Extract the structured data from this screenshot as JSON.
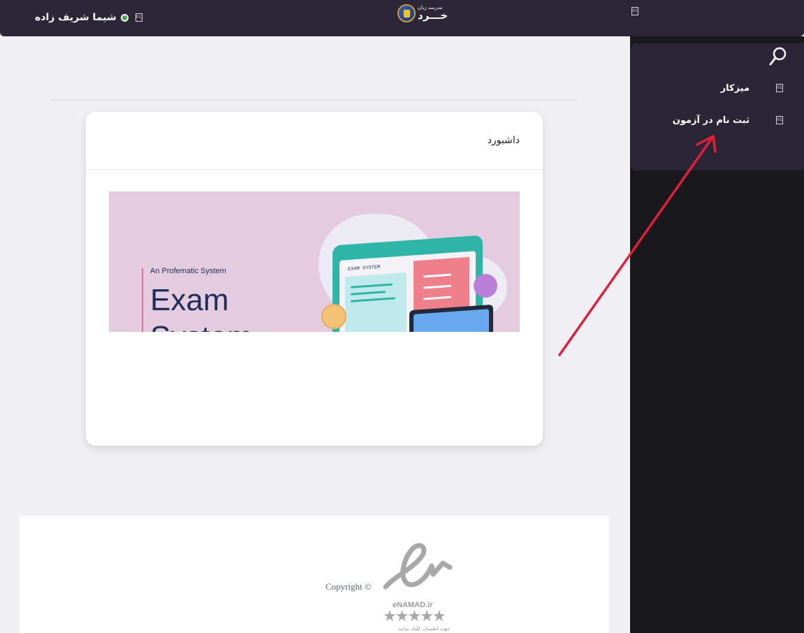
{
  "topbar": {
    "user_name": "شیما شریف زاده",
    "user_status": "online",
    "logo_small_text": "مدرسه زبان",
    "logo_big_text": "خـــرد"
  },
  "sidebar": {
    "items": [
      {
        "label": "میزکار"
      },
      {
        "label": "ثبت نام در آزمون"
      }
    ]
  },
  "main": {
    "card_title": "داشبورد",
    "banner": {
      "subtitle": "An Profematic System",
      "title": "Exam System",
      "screen_label": "EXAM SYSTEM"
    }
  },
  "footer": {
    "copyright": "Copyright ©",
    "enamad_label": "eNAMAD.ir",
    "enamad_stars": "★★★★★",
    "enamad_note": "جهت اطمینان کلیک نمایید"
  },
  "colors": {
    "topbar": "#2d2538",
    "sidebar": "#19181c",
    "sidebar_panel": "#2c2537",
    "online": "#3cb043",
    "annotation_arrow": "#e0203a"
  },
  "icons": [
    "user-icon",
    "online-dot-icon",
    "menu-toggle-icon",
    "search-icon",
    "dashboard-icon",
    "exam-register-icon"
  ]
}
